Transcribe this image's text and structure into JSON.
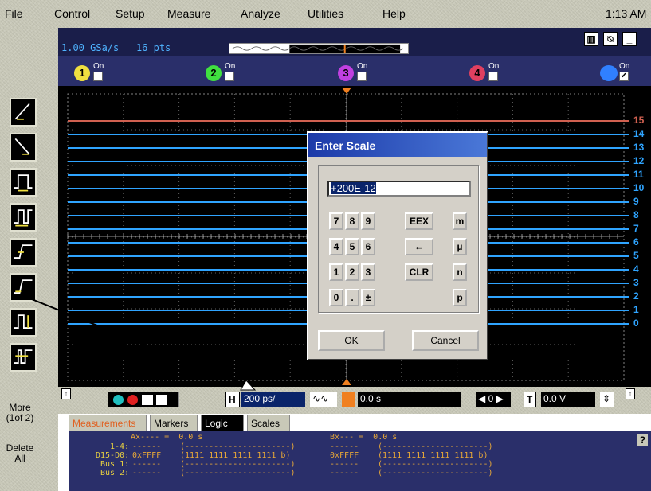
{
  "menubar": {
    "items": [
      "File",
      "Control",
      "Setup",
      "Measure",
      "Analyze",
      "Utilities",
      "Help"
    ],
    "clock": "1:13 AM"
  },
  "topbar": {
    "sample_rate": "1.00 GSa/s",
    "points": "16 pts"
  },
  "channels": [
    {
      "num": "1",
      "label": "On",
      "checked": false,
      "color": "#f0e040"
    },
    {
      "num": "2",
      "label": "On",
      "checked": false,
      "color": "#40e040"
    },
    {
      "num": "3",
      "label": "On",
      "checked": false,
      "color": "#c040e0"
    },
    {
      "num": "4",
      "label": "On",
      "checked": false,
      "color": "#e04060"
    },
    {
      "num": "",
      "label": "On",
      "checked": true,
      "color": "#3080ff"
    }
  ],
  "graph": {
    "bit_labels": [
      "15",
      "14",
      "13",
      "12",
      "11",
      "10",
      "9",
      "8",
      "7",
      "6",
      "5",
      "4",
      "3",
      "2",
      "1",
      "0"
    ],
    "bit15_color": "#d06050",
    "bit_color": "#2fa4ff"
  },
  "dialog": {
    "title": "Enter Scale",
    "input_value": "+200E-12",
    "keys_row1": [
      "7",
      "8",
      "9",
      "EEX",
      "m"
    ],
    "keys_row2": [
      "4",
      "5",
      "6",
      "←",
      "µ"
    ],
    "keys_row3": [
      "1",
      "2",
      "3",
      "CLR",
      "n"
    ],
    "keys_row4": [
      "0",
      ".",
      "±",
      "p"
    ],
    "ok_label": "OK",
    "cancel_label": "Cancel"
  },
  "leftpanel": {
    "more_label": "More",
    "more_page": "(1of 2)",
    "delete_label": "Delete",
    "delete_sub": "All"
  },
  "controlbar": {
    "h_label": "H",
    "time_scale": "200 ps/",
    "delay": "0.0 s",
    "t_label": "T",
    "trigger_level": "0.0 V"
  },
  "tabs": [
    "Measurements",
    "Markers",
    "Logic",
    "Scales"
  ],
  "measurements": {
    "ax_header": "Ax---- =  0.0 s",
    "bx_header": "Bx--- =  0.0 s",
    "rows": [
      {
        "label": "1-4:",
        "a_val": "------",
        "a_bin": "(----------------------)",
        "b_val": "------",
        "b_bin": "(----------------------)"
      },
      {
        "label": "D15-D0:",
        "a_val": "0xFFFF",
        "a_bin": "(1111 1111 1111 1111 b)",
        "b_val": "0xFFFF",
        "b_bin": "(1111 1111 1111 1111 b)"
      },
      {
        "label": "Bus 1:",
        "a_val": "------",
        "a_bin": "(----------------------)",
        "b_val": "------",
        "b_bin": "(----------------------)"
      },
      {
        "label": "Bus 2:",
        "a_val": "------",
        "a_bin": "(----------------------)",
        "b_val": "------",
        "b_bin": "(----------------------)"
      }
    ],
    "help": "?"
  }
}
